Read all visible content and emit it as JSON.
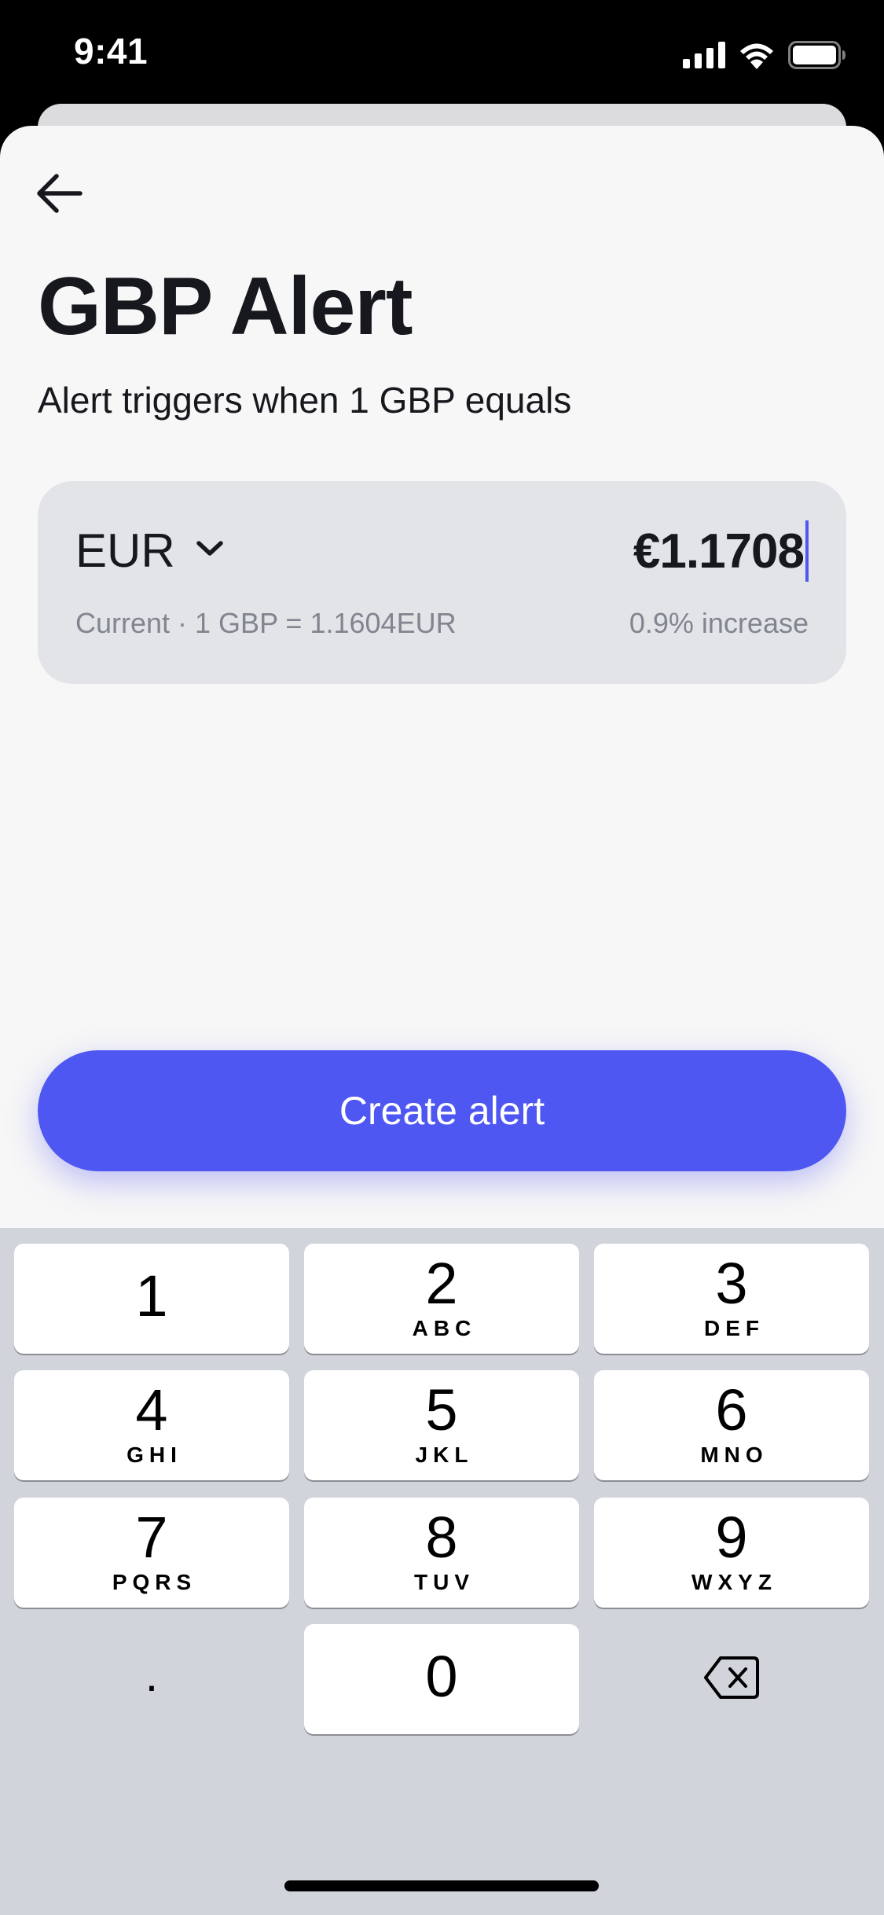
{
  "status_bar": {
    "time": "9:41",
    "icons": [
      "cellular-signal-icon",
      "wifi-icon",
      "battery-icon"
    ]
  },
  "nav": {
    "back_icon": "arrow-left-icon"
  },
  "header": {
    "title": "GBP Alert",
    "subtitle": "Alert triggers when 1 GBP equals"
  },
  "amount_card": {
    "currency": "EUR",
    "currency_icon": "chevron-down-icon",
    "amount": "€1.1708",
    "current_rate": "Current · 1 GBP = 1.1604EUR",
    "change": "0.9% increase"
  },
  "actions": {
    "create_label": "Create alert"
  },
  "keypad": {
    "keys": [
      {
        "digit": "1",
        "letters": ""
      },
      {
        "digit": "2",
        "letters": "ABC"
      },
      {
        "digit": "3",
        "letters": "DEF"
      },
      {
        "digit": "4",
        "letters": "GHI"
      },
      {
        "digit": "5",
        "letters": "JKL"
      },
      {
        "digit": "6",
        "letters": "MNO"
      },
      {
        "digit": "7",
        "letters": "PQRS"
      },
      {
        "digit": "8",
        "letters": "TUV"
      },
      {
        "digit": "9",
        "letters": "WXYZ"
      },
      {
        "digit": "0",
        "letters": ""
      }
    ],
    "decimal_label": ".",
    "delete_icon": "backspace-icon"
  },
  "colors": {
    "accent": "#4f57f2",
    "sheet_background": "#f7f7f7",
    "card_background": "#e2e4e8",
    "keypad_background": "#d1d4db",
    "muted_text": "#80858f"
  }
}
